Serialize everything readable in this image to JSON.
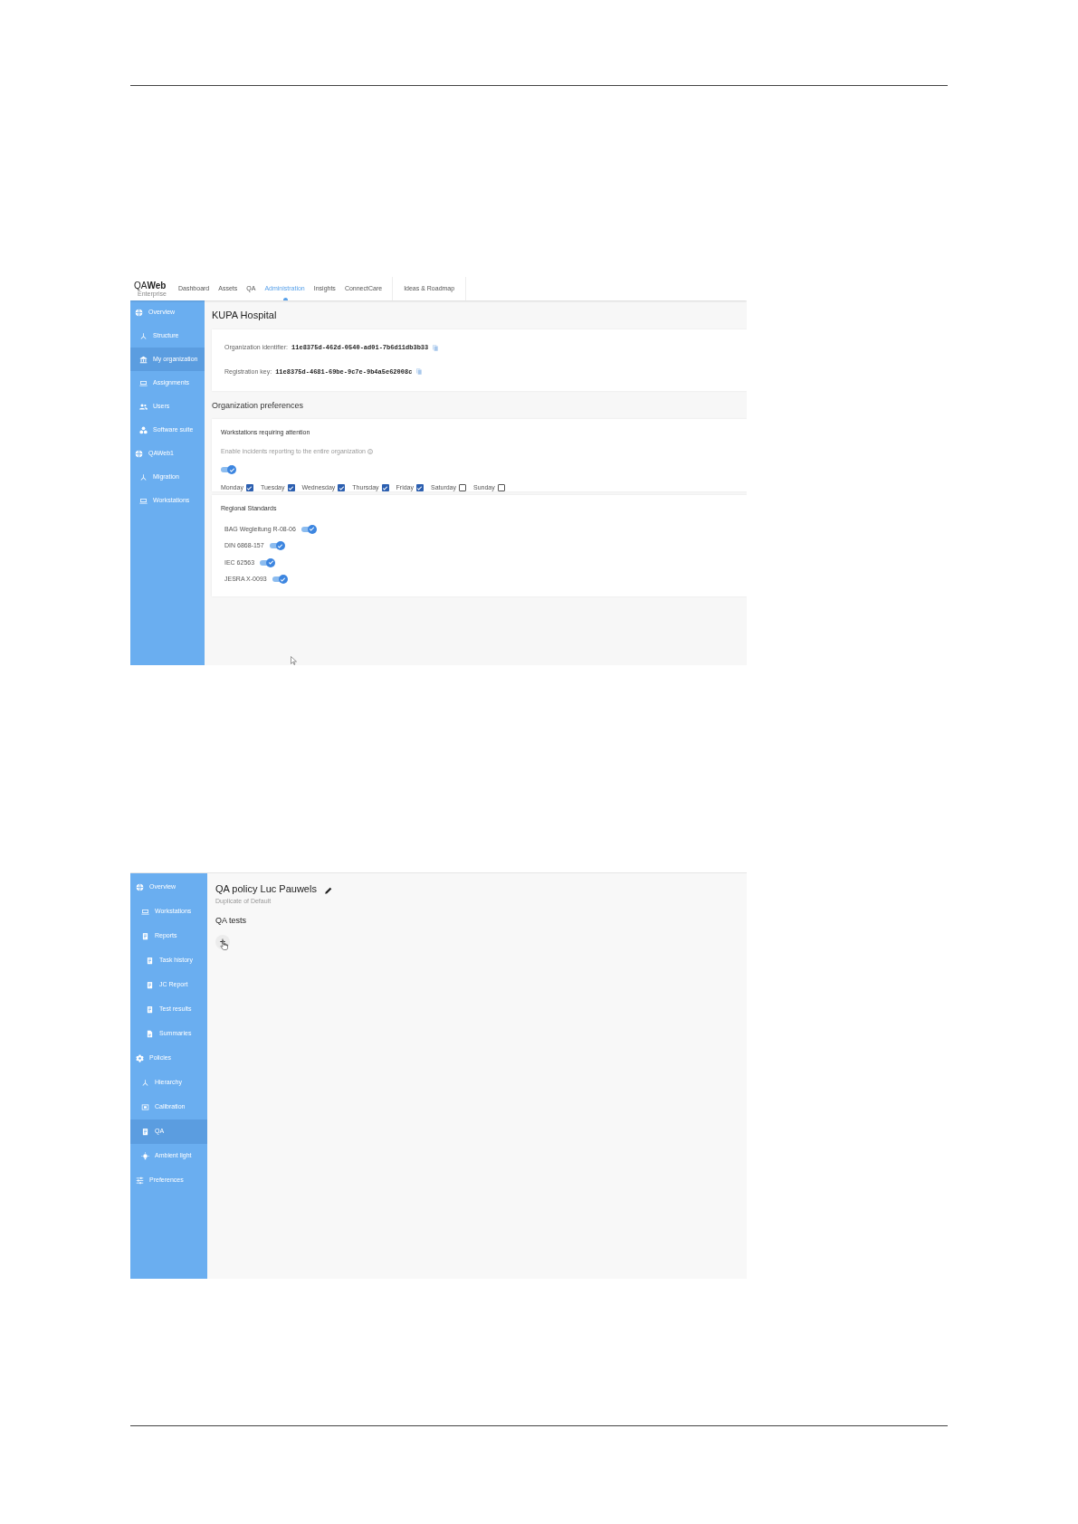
{
  "organization_screen": {
    "logo": {
      "text": "QA**Web**",
      "subtext": "Enterprise"
    },
    "nav_tabs": [
      {
        "label": "Dashboard",
        "selected": false
      },
      {
        "label": "Assets",
        "selected": false
      },
      {
        "label": "QA",
        "selected": false
      },
      {
        "label": "Administration",
        "selected": true
      },
      {
        "label": "Insights",
        "selected": false
      },
      {
        "label": "ConnectCare",
        "selected": false
      }
    ],
    "nav_extra_tab": "Ideas & Roadmap",
    "sidebar": {
      "items": [
        {
          "label": "Overview",
          "selected": false,
          "children": [
            {
              "label": "Structure",
              "selected": false
            },
            {
              "label": "My organization",
              "selected": true
            },
            {
              "label": "Assignments",
              "selected": false
            },
            {
              "label": "Users",
              "selected": false
            },
            {
              "label": "Software suite",
              "selected": false
            }
          ]
        },
        {
          "label": "QAWeb1",
          "selected": false,
          "children": [
            {
              "label": "Migration",
              "selected": false
            },
            {
              "label": "Workstations",
              "selected": false
            }
          ]
        }
      ]
    },
    "title": "KUPA Hospital",
    "identifiers": [
      {
        "label": "Organization identifier:",
        "value": "11e8375d-462d-0540-ad01-7b6d11db3b33"
      },
      {
        "label": "Registration key:",
        "value": "11e8375d-4681-69be-9c7e-9b4a5e62008c"
      }
    ],
    "preferences_heading": "Organization preferences",
    "attention_card": {
      "title": "Workstations requiring attention",
      "hint": "Enable incidents reporting to the entire organization",
      "on": true,
      "days": [
        {
          "label": "Monday",
          "checked": true
        },
        {
          "label": "Tuesday",
          "checked": true
        },
        {
          "label": "Wednesday",
          "checked": true
        },
        {
          "label": "Thursday",
          "checked": true
        },
        {
          "label": "Friday",
          "checked": true
        },
        {
          "label": "Saturday",
          "checked": false
        },
        {
          "label": "Sunday",
          "checked": false
        }
      ]
    },
    "standards_card": {
      "title": "Regional Standards",
      "items": [
        {
          "label": "BAG Wegleitung R-08-06",
          "on": true
        },
        {
          "label": "DIN 6868-157",
          "on": true
        },
        {
          "label": "IEC 62563",
          "on": true
        },
        {
          "label": "JESRA X-0093",
          "on": true
        }
      ]
    }
  },
  "policy_screen": {
    "sidebar": {
      "items": [
        {
          "label": "Overview",
          "selected": false,
          "children": [
            {
              "label": "Workstations",
              "selected": false
            },
            {
              "label": "Reports",
              "selected": false,
              "children": [
                {
                  "label": "Task history",
                  "selected": false
                },
                {
                  "label": "JC Report",
                  "selected": false
                },
                {
                  "label": "Test results",
                  "selected": false
                },
                {
                  "label": "Summaries",
                  "selected": false
                }
              ]
            }
          ]
        },
        {
          "label": "Policies",
          "selected": false,
          "children": [
            {
              "label": "Hierarchy",
              "selected": false
            },
            {
              "label": "Calibration",
              "selected": false
            },
            {
              "label": "QA",
              "selected": true
            },
            {
              "label": "Ambient light",
              "selected": false
            }
          ]
        },
        {
          "label": "Preferences",
          "selected": false
        }
      ]
    },
    "title": "QA policy Luc Pauwels",
    "subtitle": "Duplicate of Default",
    "section": "QA tests",
    "add_button": "+"
  }
}
